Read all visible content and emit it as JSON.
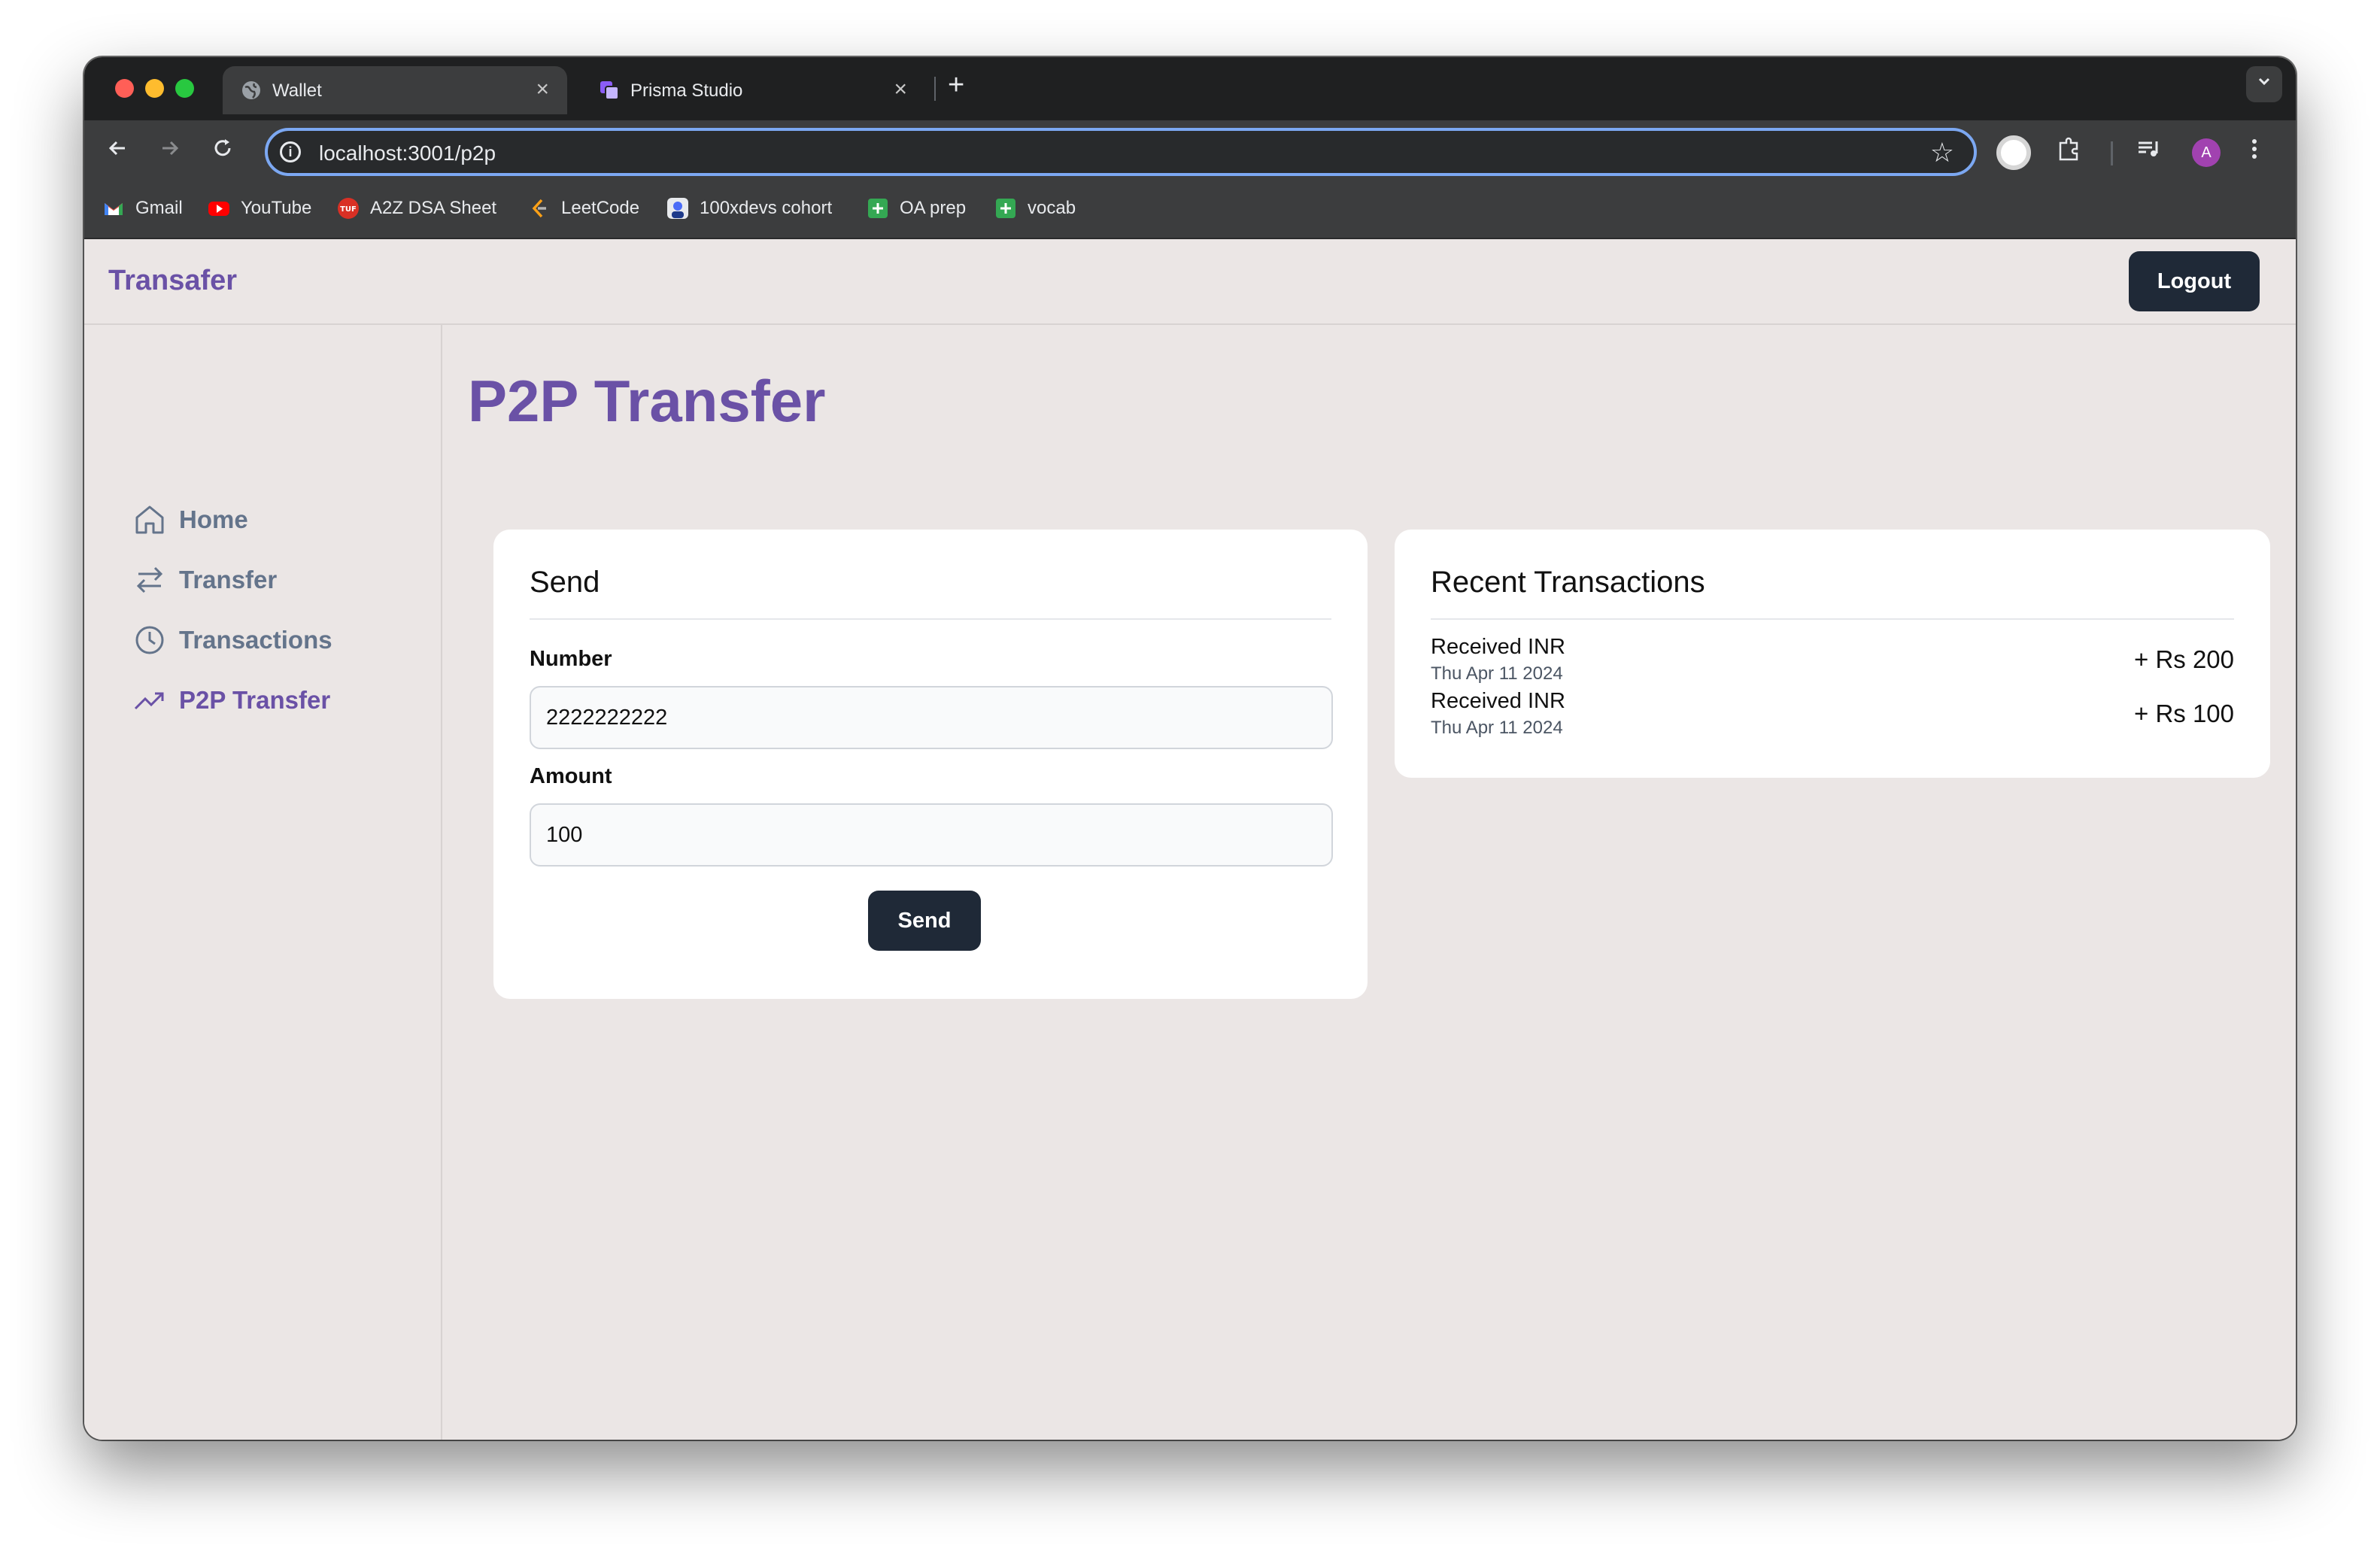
{
  "browser": {
    "tabs": [
      {
        "title": "Wallet",
        "active": true,
        "close": "×"
      },
      {
        "title": "Prisma Studio",
        "active": false,
        "close": "×"
      }
    ],
    "new_tab": "+",
    "url": "localhost:3001/p2p",
    "bookmarks": [
      {
        "label": "Gmail",
        "icon": "gmail-icon",
        "color": "#ea4335"
      },
      {
        "label": "YouTube",
        "icon": "youtube-icon",
        "color": "#ff0000"
      },
      {
        "label": "A2Z DSA Sheet",
        "icon": "tuf-icon",
        "color": "#d93025"
      },
      {
        "label": "LeetCode",
        "icon": "leetcode-icon",
        "color": "#ffa116"
      },
      {
        "label": "100xdevs cohort",
        "icon": "cohort-icon",
        "color": "#4a6cf7"
      },
      {
        "label": "OA prep",
        "icon": "sheets-icon",
        "color": "#34a853"
      },
      {
        "label": "vocab",
        "icon": "sheets-icon",
        "color": "#34a853"
      }
    ],
    "profile_initial": "A"
  },
  "app": {
    "brand": "Transafer",
    "logout_label": "Logout",
    "accent": "#6a51a6",
    "sidebar": [
      {
        "label": "Home",
        "icon": "home-icon",
        "active": false
      },
      {
        "label": "Transfer",
        "icon": "arrows-icon",
        "active": false
      },
      {
        "label": "Transactions",
        "icon": "clock-icon",
        "active": false
      },
      {
        "label": "P2P Transfer",
        "icon": "trending-up-icon",
        "active": true
      }
    ],
    "page_title": "P2P Transfer",
    "send_card": {
      "title": "Send",
      "number_label": "Number",
      "number_value": "2222222222",
      "amount_label": "Amount",
      "amount_value": "100",
      "button_label": "Send"
    },
    "recent": {
      "title": "Recent Transactions",
      "items": [
        {
          "title": "Received INR",
          "date": "Thu Apr 11 2024",
          "amount": "+ Rs 200"
        },
        {
          "title": "Received INR",
          "date": "Thu Apr 11 2024",
          "amount": "+ Rs 100"
        }
      ]
    }
  }
}
